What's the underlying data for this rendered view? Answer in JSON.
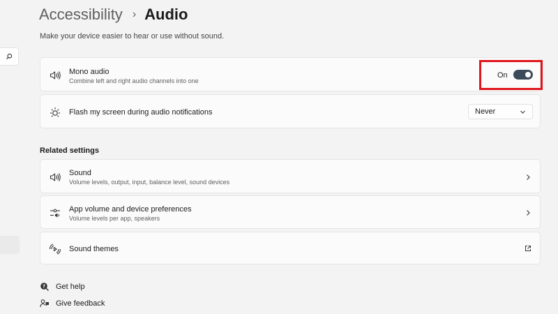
{
  "header": {
    "breadcrumb_parent": "Accessibility",
    "breadcrumb_separator": "›",
    "page_title": "Audio",
    "subtitle": "Make your device easier to hear or use without sound."
  },
  "settings": {
    "mono_audio": {
      "title": "Mono audio",
      "description": "Combine left and right audio channels into one",
      "state_label": "On",
      "enabled": true,
      "icon": "speaker-icon"
    },
    "flash_screen": {
      "title": "Flash my screen during audio notifications",
      "selected": "Never",
      "icon": "flash-icon"
    }
  },
  "related": {
    "heading": "Related settings",
    "items": [
      {
        "title": "Sound",
        "description": "Volume levels, output, input, balance level, sound devices",
        "icon": "speaker-icon",
        "action": "chevron-right-icon"
      },
      {
        "title": "App volume and device preferences",
        "description": "Volume levels per app, speakers",
        "icon": "mixer-icon",
        "action": "chevron-right-icon"
      },
      {
        "title": "Sound themes",
        "icon": "sound-themes-icon",
        "action": "external-link-icon"
      }
    ]
  },
  "footer": {
    "get_help": "Get help",
    "give_feedback": "Give feedback"
  },
  "colors": {
    "background": "#f3f3f3",
    "card": "#fbfbfb",
    "toggle_on": "#3c4b5a",
    "highlight": "#e0151b"
  }
}
